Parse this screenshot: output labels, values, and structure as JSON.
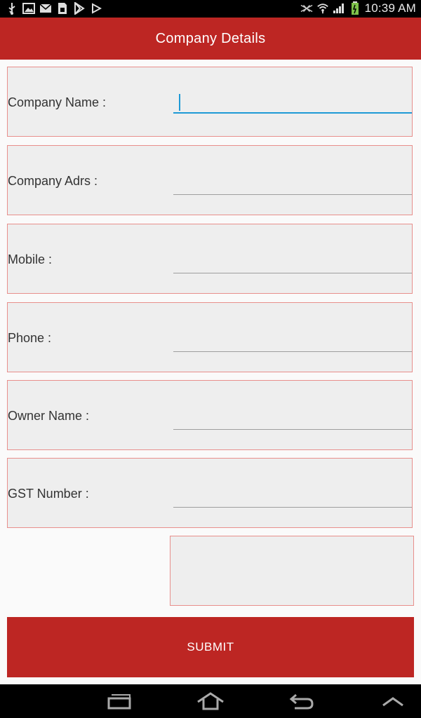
{
  "status_bar": {
    "time": "10:39 AM",
    "left_icons": [
      "usb-icon",
      "image-icon",
      "email-icon",
      "sim-card-icon",
      "play-store-icon",
      "play-icon"
    ],
    "right_icons": [
      "signal-mute-icon",
      "wifi-icon",
      "cell-signal-icon",
      "battery-icon"
    ]
  },
  "app_bar": {
    "title": "Company Details",
    "color": "#bd2623"
  },
  "form": {
    "fields": [
      {
        "label": "Company Name :",
        "value": "",
        "focused": true
      },
      {
        "label": "Company Adrs :",
        "value": ""
      },
      {
        "label": "Mobile :",
        "value": ""
      },
      {
        "label": "Phone :",
        "value": ""
      },
      {
        "label": "Owner Name :",
        "value": ""
      },
      {
        "label": "GST Number :",
        "value": ""
      }
    ],
    "submit_label": "SUBMIT"
  },
  "nav_bar": {
    "icons": [
      "recent-apps-icon",
      "home-icon",
      "back-icon",
      "expand-up-icon"
    ]
  }
}
